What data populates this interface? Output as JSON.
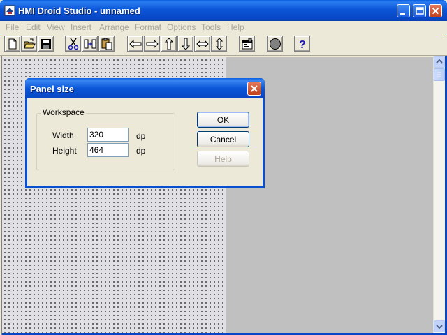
{
  "window": {
    "title": "HMI Droid Studio - unnamed"
  },
  "menu": [
    "File",
    "Edit",
    "View",
    "Insert",
    "Arrange",
    "Format",
    "Options",
    "Tools",
    "Help"
  ],
  "toolbar": [
    {
      "name": "new-icon"
    },
    {
      "name": "open-folder-icon"
    },
    {
      "name": "save-icon"
    },
    {
      "name": "cut-icon"
    },
    {
      "name": "copy-icon"
    },
    {
      "name": "paste-icon"
    },
    {
      "name": "arrow-left-icon"
    },
    {
      "name": "arrow-right-icon"
    },
    {
      "name": "arrow-up-icon"
    },
    {
      "name": "arrow-down-icon"
    },
    {
      "name": "arrow-left-right-icon"
    },
    {
      "name": "arrow-up-down-icon"
    },
    {
      "name": "properties-icon"
    },
    {
      "name": "record-circle-icon"
    },
    {
      "name": "help-question-icon"
    }
  ],
  "dialog": {
    "title": "Panel size",
    "group_label": "Workspace",
    "width_label": "Width",
    "width_value": "320",
    "height_label": "Height",
    "height_value": "464",
    "unit": "dp",
    "ok_label": "OK",
    "cancel_label": "Cancel",
    "help_label": "Help"
  },
  "colors": {
    "titlebar": "#0846c4",
    "face": "#ece9d8",
    "work_gray": "#c0c0c0",
    "close_red": "#c1401c"
  }
}
